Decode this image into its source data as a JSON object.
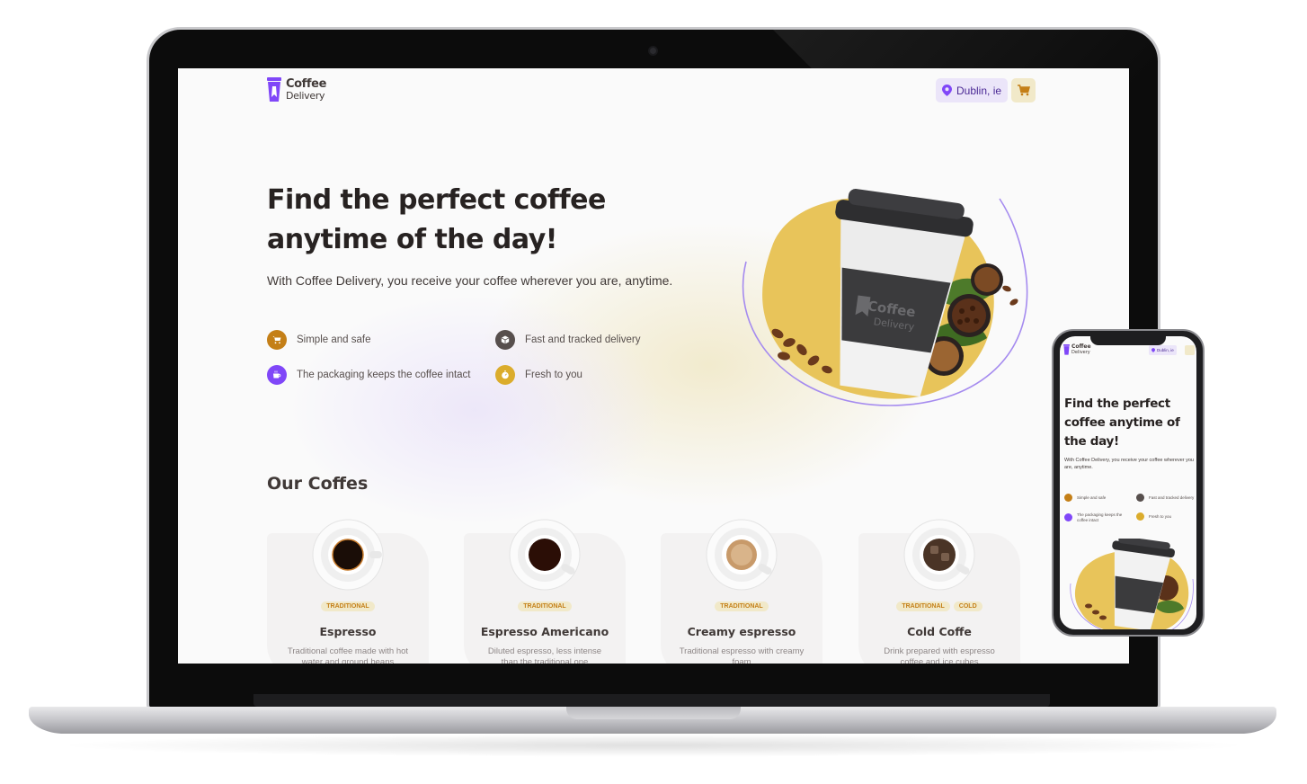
{
  "brand": {
    "line1": "Coffee",
    "line2": "Delivery"
  },
  "header": {
    "location": "Dublin, ie"
  },
  "hero": {
    "title": "Find the perfect coffee anytime of the day!",
    "subtitle": "With Coffee Delivery, you receive your coffee wherever you are, anytime.",
    "features": [
      {
        "label": "Simple and safe",
        "icon": "cart-icon",
        "color": "#c47f17"
      },
      {
        "label": "Fast and tracked delivery",
        "icon": "package-icon",
        "color": "#574f4d"
      },
      {
        "label": "The packaging keeps the coffee intact",
        "icon": "coffee-icon",
        "color": "#8047f8"
      },
      {
        "label": "Fresh to you",
        "icon": "timer-icon",
        "color": "#dbac2c"
      }
    ],
    "cup_logo": {
      "line1": "Coffee",
      "line2": "Delivery"
    }
  },
  "section": {
    "title": "Our Coffes"
  },
  "coffees": [
    {
      "name": "Espresso",
      "tags": [
        "TRADITIONAL"
      ],
      "description": "Traditional coffee made with hot water and ground beans"
    },
    {
      "name": "Espresso Americano",
      "tags": [
        "TRADITIONAL"
      ],
      "description": "Diluted espresso, less intense than the traditional one"
    },
    {
      "name": "Creamy espresso",
      "tags": [
        "TRADITIONAL"
      ],
      "description": "Traditional espresso with creamy foam"
    },
    {
      "name": "Cold Coffe",
      "tags": [
        "TRADITIONAL",
        "COLD"
      ],
      "description": "Drink prepared with espresso coffee and ice cubes"
    }
  ],
  "colors": {
    "purple": "#8047f8",
    "purple_light": "#ebe5f9",
    "yellow": "#dbac2c",
    "yellow_light": "#f1e9c9",
    "yellow_dark": "#c47f17"
  },
  "phone": {
    "brand": {
      "line1": "Coffee",
      "line2": "Delivery"
    },
    "location": "Dublin, ie",
    "title": "Find the perfect coffee anytime of the day!",
    "subtitle": "With Coffee Delivery, you receive your coffee wherever you are, anytime.",
    "features": [
      "Simple and safe",
      "Fast and tracked delivery",
      "The packaging keeps the coffee intact",
      "Fresh to you"
    ]
  }
}
